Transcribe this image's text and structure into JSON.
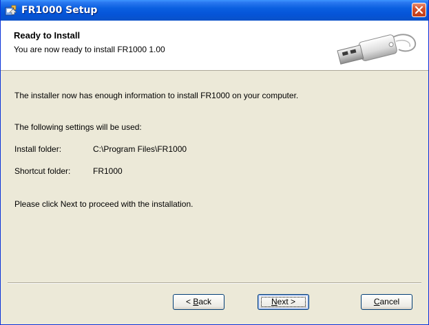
{
  "window": {
    "title": "FR1000 Setup",
    "close_symbol": "✕"
  },
  "header": {
    "title": "Ready to Install",
    "subtitle": "You are now ready to install FR1000 1.00",
    "image_icon": "usb-drive-icon"
  },
  "body": {
    "intro": "The installer now has enough information to install FR1000 on your computer.",
    "settings_intro": "The following settings will be used:",
    "settings": [
      {
        "label": "Install folder:",
        "value": "C:\\Program Files\\FR1000"
      },
      {
        "label": "Shortcut folder:",
        "value": "FR1000"
      }
    ],
    "instruction": "Please click Next to proceed with the installation."
  },
  "buttons": {
    "back": {
      "prefix": "< ",
      "mnemonic": "B",
      "rest": "ack"
    },
    "next": {
      "mnemonic": "N",
      "rest": "ext >"
    },
    "cancel": {
      "mnemonic": "C",
      "rest": "ancel"
    }
  },
  "colors": {
    "titlebar": "#0554d8",
    "dialog_background": "#ece9d8",
    "button_border": "#003c74",
    "close_button": "#c13d17"
  }
}
